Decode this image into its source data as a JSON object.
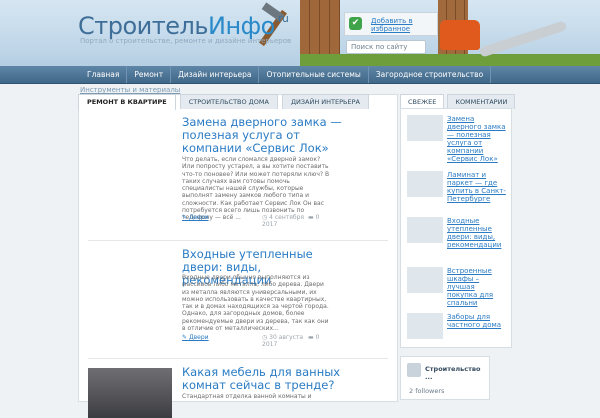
{
  "site": {
    "logo_a": "Строитель",
    "logo_b": "Инфо",
    "logo_c": ".ru",
    "tagline": "Портал о строительстве, ремонте и дизайне интерьеров"
  },
  "header": {
    "favorite_label": "Добавить в избранное",
    "search_placeholder": "Поиск по сайту"
  },
  "nav": [
    "Главная",
    "Ремонт",
    "Дизайн интерьера",
    "Отопительные системы",
    "Загородное строительство"
  ],
  "breadcrumb": "Инструменты и материалы",
  "tabs": [
    "Ремонт в квартире",
    "Строительство дома",
    "Дизайн интерьера"
  ],
  "posts": [
    {
      "title": "Замена дверного замка — полезная услуга от компании «Сервис Лок»",
      "excerpt": "Что делать, если сломался дверной замок? Или попросту устарел, а вы хотите поставить что-то поновее? Или может потеряли ключ? В таких случаях вам готовы помочь специалисты нашей службы, которые выполнят замену замков любого типа и сложности. Как работает Сервис Лок Он вас потребуется всего лишь позвонить по телефону — всё ...",
      "category": "Двери",
      "date": "4 сентября 2017",
      "comments": "0"
    },
    {
      "title": "Входные утепленные двери: виды, рекомендации",
      "excerpt": "Входные двери обычно выполняются из массивов либо металла, либо дерева. Двери из металла являются универсальными, их можно использовать в качестве квартирных, так и в домах находящихся за чертой города.   Однако, для загородных домов, более рекомендуемые двери из дерева, так как они в отличие от металлических...",
      "category": "Двери",
      "date": "30 августа 2017",
      "comments": "0"
    },
    {
      "title": "Какая мебель для ванных комнат сейчас в тренде?",
      "excerpt": "Стандартная отделка ванной комнаты и"
    }
  ],
  "sidebar": {
    "tabs": [
      "Свежее",
      "Комментарии"
    ],
    "items": [
      "Замена дверного замка — полезная услуга от компании «Сервис Лок»",
      "Ламинат и паркет — где купить в Санкт-Петербурге",
      "Входные утепленные двери: виды, рекомендации",
      "Встроенные шкафы – лучшая покупка для спальни",
      "Заборы для частного дома"
    ],
    "widget_name": "Строительство ...",
    "followers": "2 followers"
  }
}
